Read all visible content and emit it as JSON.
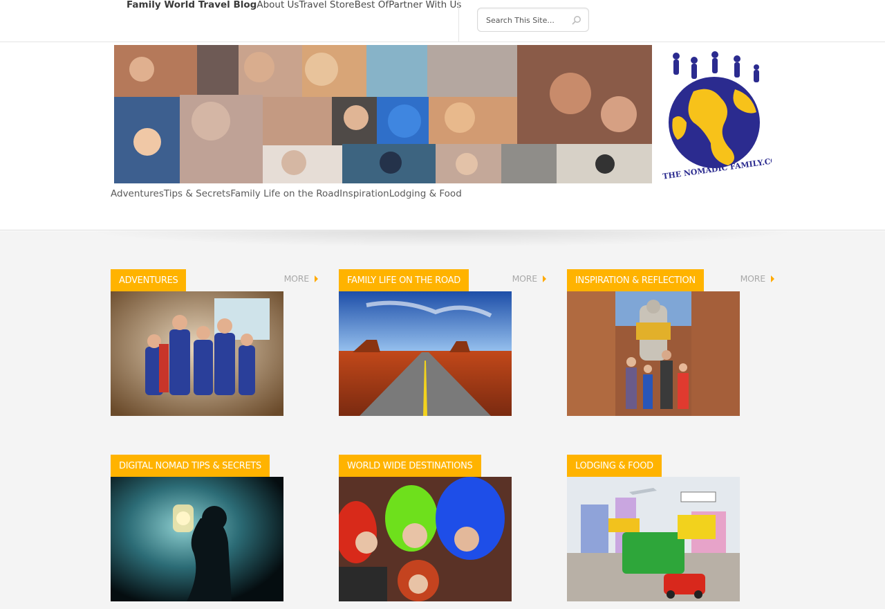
{
  "top_nav": {
    "items": [
      {
        "label": "Family World Travel Blog",
        "brand": true
      },
      {
        "label": "About Us"
      },
      {
        "label": "Travel Store"
      },
      {
        "label": "Best Of"
      },
      {
        "label": "Partner With Us"
      }
    ]
  },
  "search": {
    "placeholder": "Search This Site...",
    "icon": "search-icon"
  },
  "header": {
    "collage_alt": "family photo collage",
    "logo_text": "THE NOMADIC FAMILY.COM",
    "logo_colors": {
      "globe_ocean": "#2b2b8f",
      "globe_land": "#f7c21a"
    }
  },
  "main_nav": {
    "items": [
      "Adventures",
      "Tips & Secrets",
      "Family Life on the Road",
      "Inspiration",
      "Lodging & Food"
    ]
  },
  "categories": [
    {
      "title": "ADVENTURES",
      "more": "MORE"
    },
    {
      "title": "FAMILY LIFE ON THE ROAD",
      "more": "MORE"
    },
    {
      "title": "INSPIRATION & REFLECTION",
      "more": "MORE"
    },
    {
      "title": "DIGITAL NOMAD TIPS & SECRETS",
      "more": ""
    },
    {
      "title": "WORLD WIDE DESTINATIONS",
      "more": ""
    },
    {
      "title": "LODGING & FOOD",
      "more": ""
    }
  ],
  "colors": {
    "accent": "#ffb300",
    "more_arrow": "#ffaa00",
    "background": "#f4f4f4"
  }
}
